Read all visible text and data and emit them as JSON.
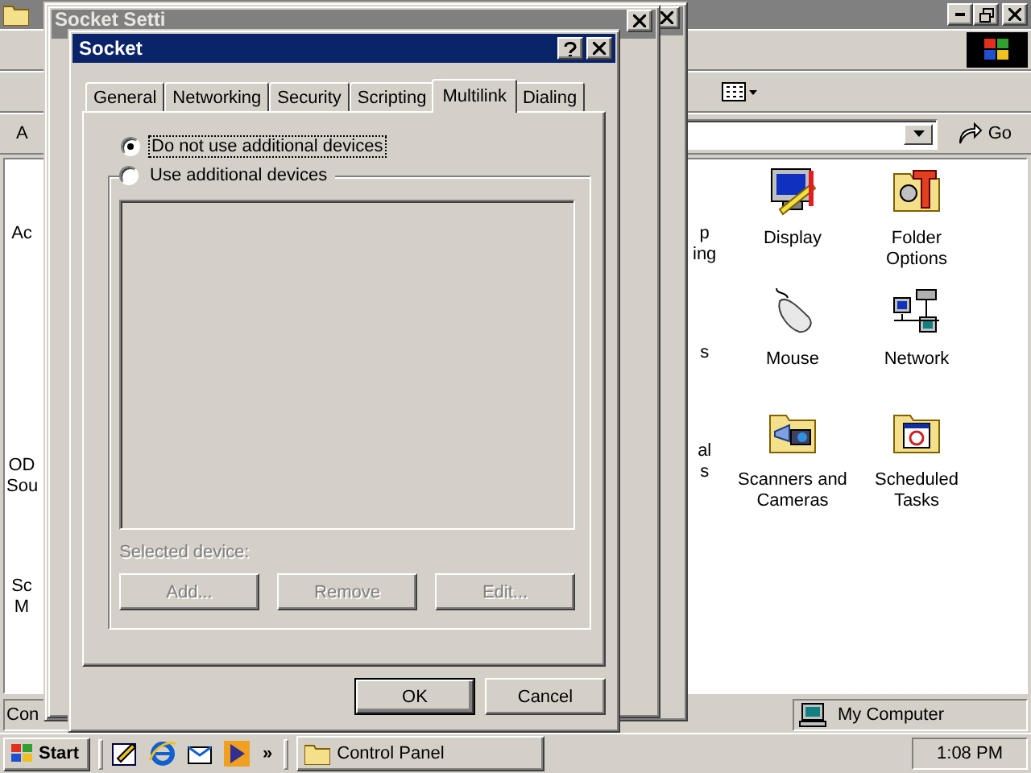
{
  "control_panel": {
    "address_label": "A",
    "go_label": "Go",
    "cut_labels_left": [
      {
        "lines": [
          "Ac"
        ]
      },
      {
        "lines": [
          "OD",
          "Sou"
        ]
      },
      {
        "lines": [
          "Sc",
          "M"
        ]
      }
    ],
    "cut_labels_right": [
      {
        "lines": [
          "p",
          "ing"
        ]
      },
      {
        "lines": [
          "s"
        ]
      },
      {
        "lines": [
          "al",
          "s"
        ]
      }
    ],
    "icons": [
      {
        "label": "Display",
        "kind": "display"
      },
      {
        "label": "Folder Options",
        "kind": "folder-options"
      },
      {
        "label": "Mouse",
        "kind": "mouse"
      },
      {
        "label": "Network",
        "kind": "network"
      },
      {
        "label": "Scanners and Cameras",
        "kind": "scanner"
      },
      {
        "label": "Scheduled Tasks",
        "kind": "tasks"
      }
    ],
    "status_bar": {
      "left": "Con",
      "zone": "My Computer"
    }
  },
  "back_dialog": {
    "title": "Socket Setti"
  },
  "dialog": {
    "title": "Socket",
    "tabs": [
      {
        "label": "General",
        "selected": false
      },
      {
        "label": "Networking",
        "selected": false
      },
      {
        "label": "Security",
        "selected": false
      },
      {
        "label": "Scripting",
        "selected": false
      },
      {
        "label": "Multilink",
        "selected": true
      },
      {
        "label": "Dialing",
        "selected": false
      }
    ],
    "options": [
      {
        "label": "Do not use additional devices",
        "selected": true,
        "focused": true
      },
      {
        "label": "Use additional devices",
        "selected": false,
        "focused": false
      }
    ],
    "group_disabled": true,
    "selected_device_label": "Selected device:",
    "device_buttons": [
      {
        "label": "Add...",
        "disabled": true
      },
      {
        "label": "Remove",
        "disabled": true
      },
      {
        "label": "Edit...",
        "disabled": true
      }
    ],
    "footer_buttons": [
      {
        "label": "OK",
        "default": true
      },
      {
        "label": "Cancel",
        "default": false
      }
    ]
  },
  "taskbar": {
    "start": "Start",
    "chevron": "»",
    "tasks": [
      {
        "label": "Control Panel",
        "selected": false
      }
    ],
    "clock": "1:08 PM"
  }
}
